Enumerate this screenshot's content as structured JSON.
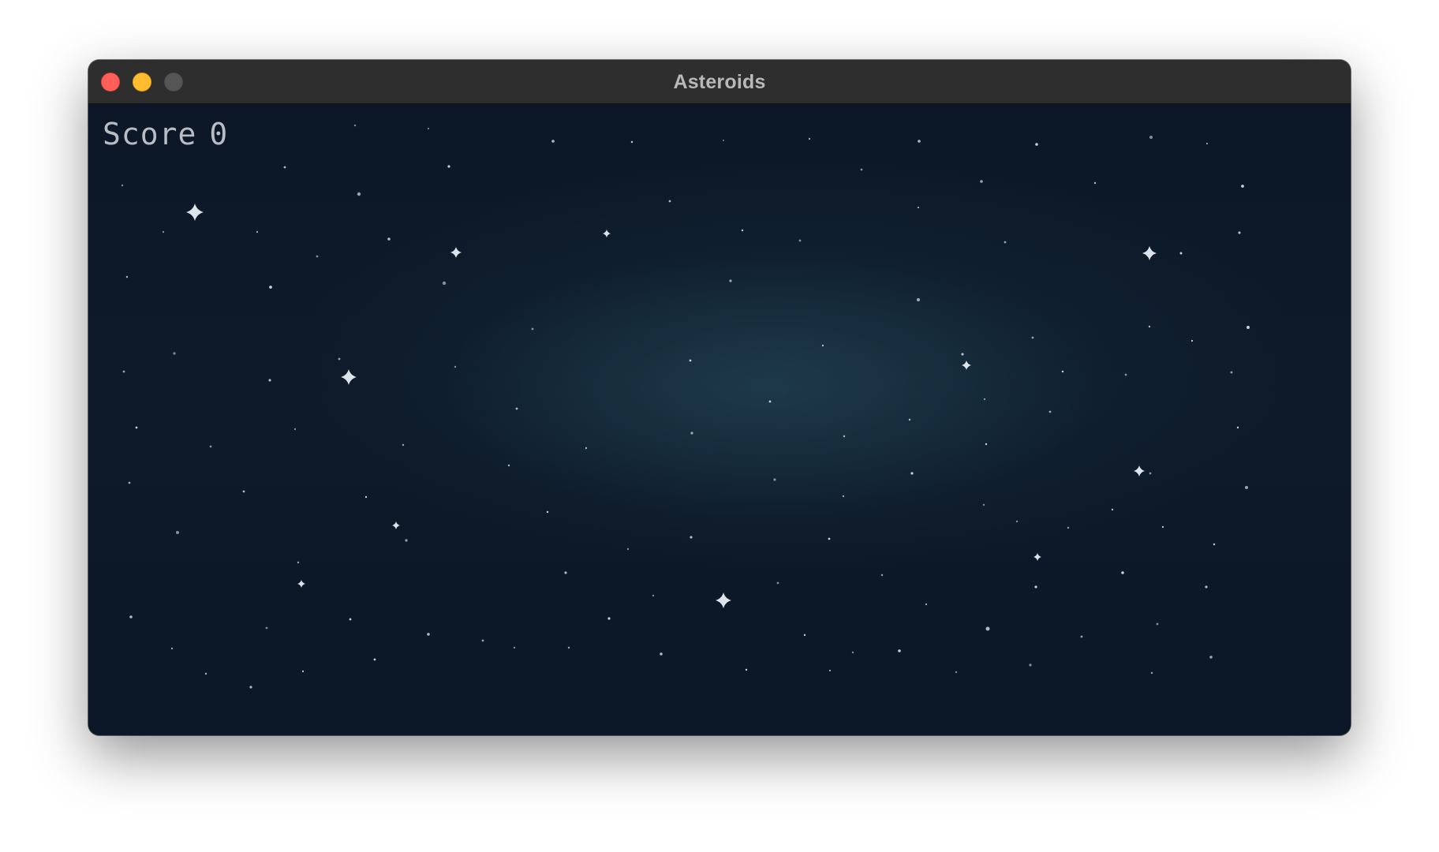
{
  "window": {
    "title": "Asteroids",
    "controls": {
      "close": "close-window",
      "minimize": "minimize-window",
      "zoom": "zoom-window"
    }
  },
  "hud": {
    "score_label": "Score",
    "score_value": "0"
  },
  "colors": {
    "space_background": "#0c1727",
    "nebula": "#264856",
    "star": "#e8eef5",
    "hud_text": "#b9bcc2",
    "titlebar": "#2e2e2e"
  }
}
